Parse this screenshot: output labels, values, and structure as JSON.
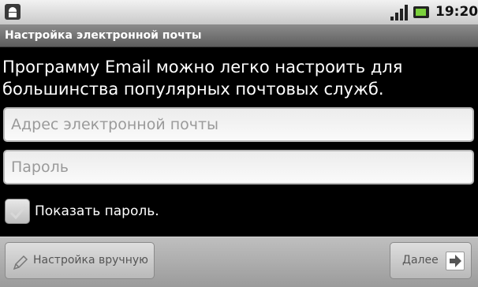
{
  "status_bar": {
    "time": "19:20",
    "icons": [
      "android-notification-icon",
      "signal-icon",
      "battery-icon"
    ],
    "battery_color": "#7bd13c"
  },
  "title_bar": {
    "title": "Настройка электронной почты"
  },
  "intro_text": "Программу Email можно легко настроить для большинства популярных почтовых служб.",
  "email_field": {
    "placeholder": "Адрес электронной почты",
    "value": ""
  },
  "password_field": {
    "placeholder": "Пароль",
    "value": ""
  },
  "show_password": {
    "label": "Показать пароль.",
    "checked": true
  },
  "buttons": {
    "manual_setup": {
      "label": "Настройка вручную",
      "icon": "pencil-icon"
    },
    "next": {
      "label": "Далее",
      "icon": "arrow-right-icon"
    }
  }
}
